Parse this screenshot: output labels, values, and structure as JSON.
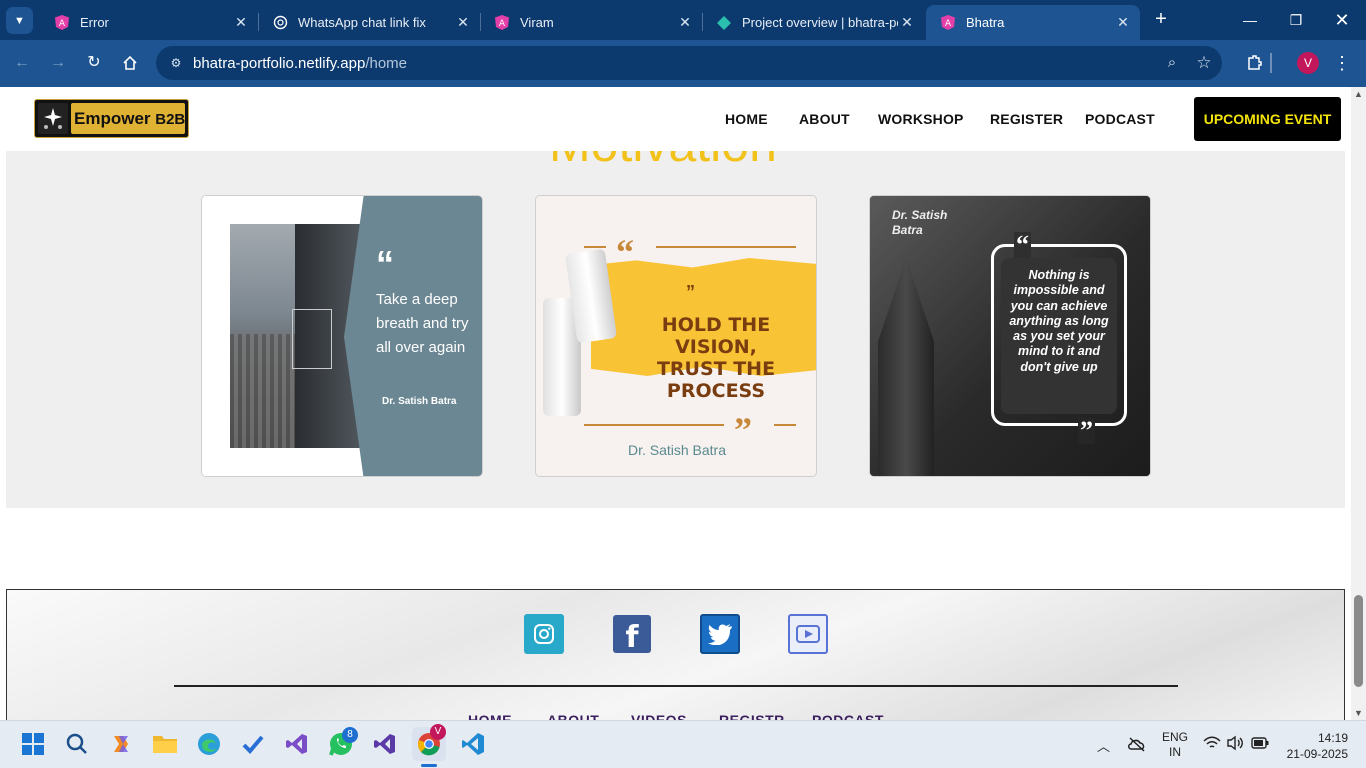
{
  "browser": {
    "tabs": [
      {
        "title": "Error",
        "favicon": "angular-icon",
        "active": false
      },
      {
        "title": "WhatsApp chat link fix",
        "favicon": "chatgpt-icon",
        "active": false
      },
      {
        "title": "Viram",
        "favicon": "angular-icon",
        "active": false
      },
      {
        "title": "Project overview | bhatra-po",
        "favicon": "netlify-icon",
        "active": false
      },
      {
        "title": "Bhatra",
        "favicon": "angular-icon",
        "active": true
      }
    ],
    "url_host": "bhatra-portfolio.netlify.app",
    "url_path": "/home",
    "profile_initial": "V"
  },
  "site": {
    "logo_text_1": "Empower ",
    "logo_text_2": "B2B",
    "nav": [
      "HOME",
      "ABOUT",
      "WORKSHOP",
      "REGISTER",
      "PODCAST"
    ],
    "cta": "UPCOMING EVENT",
    "section_heading": "Motivation",
    "cards": [
      {
        "quote": "Take a deep breath and try all over again",
        "author": "Dr. Satish Batra"
      },
      {
        "quote_line_1": "HOLD THE VISION,",
        "quote_line_2": "TRUST THE PROCESS",
        "author": "Dr. Satish Batra"
      },
      {
        "quote": "Nothing is impossible and you can achieve anything as long as you set your mind to it and don't give up",
        "author_line_1": "Dr. Satish",
        "author_line_2": "Batra"
      }
    ],
    "social_icons": [
      "instagram-icon",
      "facebook-icon",
      "twitter-icon",
      "youtube-icon"
    ],
    "footer_links": [
      "HOME",
      "ABOUT",
      "VIDEOS",
      "REGISTR",
      "PODCAST"
    ]
  },
  "taskbar": {
    "whatsapp_badge": "8",
    "chrome_badge": "V",
    "lang_1": "ENG",
    "lang_2": "IN",
    "time": "14:19",
    "date": "21-09-2025"
  },
  "colors": {
    "chrome_dark": "#0c3a6e",
    "chrome_light": "#1d5491",
    "heading_yellow": "#f2c11a",
    "cta_yellow": "#f4e40a"
  }
}
